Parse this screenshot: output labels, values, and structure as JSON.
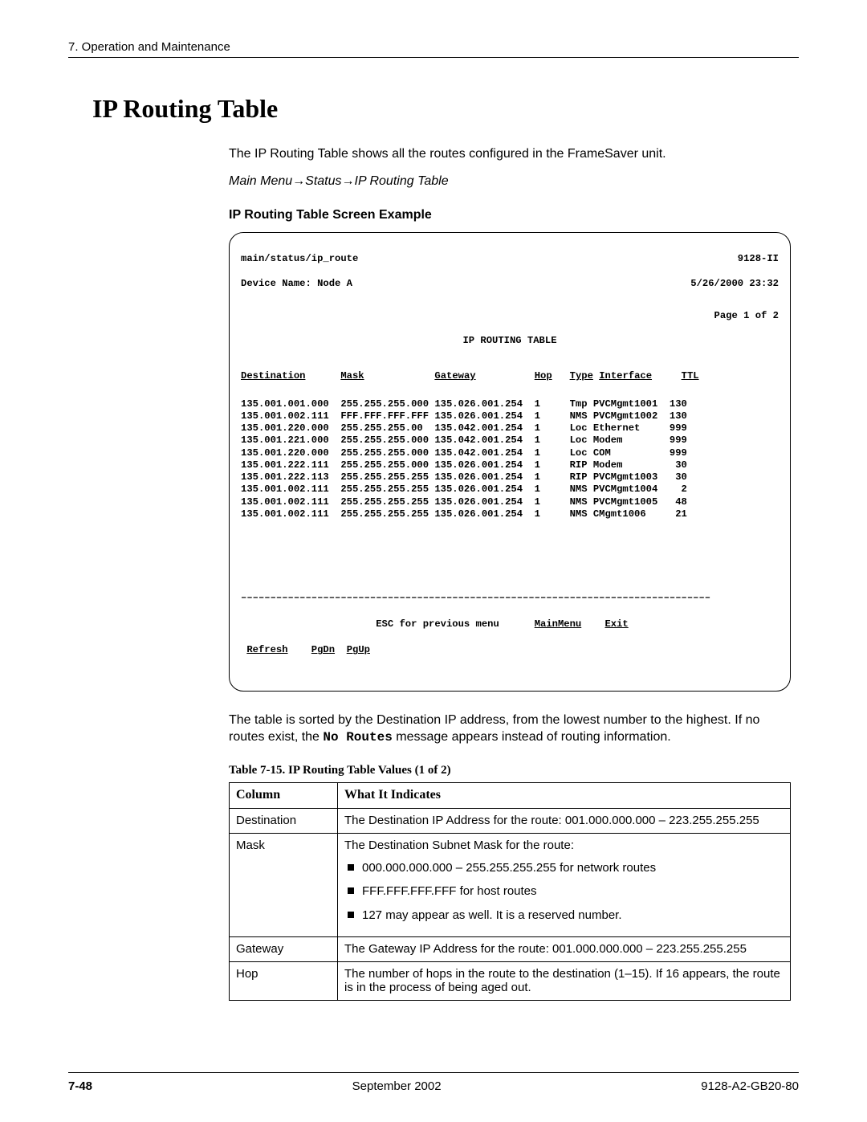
{
  "header": {
    "running": "7. Operation and Maintenance"
  },
  "section_title": "IP Routing Table",
  "intro": "The IP Routing Table shows all the routes configured in the FrameSaver unit.",
  "nav_path": "Main Menu→Status→IP Routing Table",
  "screen_example_label": "IP Routing Table Screen Example",
  "terminal": {
    "path": "main/status/ip_route",
    "model": "9128-II",
    "device_label": "Device Name: Node A",
    "timestamp": "5/26/2000 23:32",
    "page_indicator": "Page 1 of 2",
    "title": "IP ROUTING TABLE",
    "column_headers": {
      "dest": "Destination",
      "mask": "Mask",
      "gateway": "Gateway",
      "hop": "Hop",
      "type": "Type",
      "interface": "Interface",
      "ttl": "TTL"
    },
    "rows": [
      {
        "dest": "135.001.001.000",
        "mask": "255.255.255.000",
        "gateway": "135.026.001.254",
        "hop": "1",
        "type": "Tmp",
        "iface": "PVCMgmt1001",
        "ttl": "130"
      },
      {
        "dest": "135.001.002.111",
        "mask": "FFF.FFF.FFF.FFF",
        "gateway": "135.026.001.254",
        "hop": "1",
        "type": "NMS",
        "iface": "PVCMgmt1002",
        "ttl": "130"
      },
      {
        "dest": "135.001.220.000",
        "mask": "255.255.255.00",
        "gateway": "135.042.001.254",
        "hop": "1",
        "type": "Loc",
        "iface": "Ethernet",
        "ttl": "999"
      },
      {
        "dest": "135.001.221.000",
        "mask": "255.255.255.000",
        "gateway": "135.042.001.254",
        "hop": "1",
        "type": "Loc",
        "iface": "Modem",
        "ttl": "999"
      },
      {
        "dest": "135.001.220.000",
        "mask": "255.255.255.000",
        "gateway": "135.042.001.254",
        "hop": "1",
        "type": "Loc",
        "iface": "COM",
        "ttl": "999"
      },
      {
        "dest": "135.001.222.111",
        "mask": "255.255.255.000",
        "gateway": "135.026.001.254",
        "hop": "1",
        "type": "RIP",
        "iface": "Modem",
        "ttl": "30"
      },
      {
        "dest": "135.001.222.113",
        "mask": "255.255.255.255",
        "gateway": "135.026.001.254",
        "hop": "1",
        "type": "RIP",
        "iface": "PVCMgmt1003",
        "ttl": "30"
      },
      {
        "dest": "135.001.002.111",
        "mask": "255.255.255.255",
        "gateway": "135.026.001.254",
        "hop": "1",
        "type": "NMS",
        "iface": "PVCMgmt1004",
        "ttl": "2"
      },
      {
        "dest": "135.001.002.111",
        "mask": "255.255.255.255",
        "gateway": "135.026.001.254",
        "hop": "1",
        "type": "NMS",
        "iface": "PVCMgmt1005",
        "ttl": "48"
      },
      {
        "dest": "135.001.002.111",
        "mask": "255.255.255.255",
        "gateway": "135.026.001.254",
        "hop": "1",
        "type": "NMS",
        "iface": "CMgmt1006",
        "ttl": "21"
      }
    ],
    "separator": "––––––––––––––––––––––––––––––––––––––––––––––––––––––––––––––––––––––––––––––––",
    "footer_line1_prefix": "ESC for previous menu",
    "footer_line1_menu": "MainMenu",
    "footer_line1_exit": "Exit",
    "footer_line2_refresh": "Refresh",
    "footer_line2_pgdn": "PgDn",
    "footer_line2_pgup": "PgUp"
  },
  "after_para_pre": "The table is sorted by the Destination IP address, from the lowest number to the highest. If no routes exist, the ",
  "after_para_mono": "No Routes",
  "after_para_post": " message appears instead of routing information.",
  "table_caption": "Table 7-15.  IP Routing Table Values (1 of 2)",
  "values_table": {
    "head_col": "Column",
    "head_desc": "What It Indicates",
    "rows": [
      {
        "col": "Destination",
        "desc": "The Destination IP Address for the route: 001.000.000.000 – 223.255.255.255"
      },
      {
        "col": "Mask",
        "desc_intro": "The Destination Subnet Mask for the route:",
        "bullets": [
          "000.000.000.000 – 255.255.255.255 for network routes",
          "FFF.FFF.FFF.FFF for host routes",
          "127 may appear as well. It is a reserved number."
        ]
      },
      {
        "col": "Gateway",
        "desc": "The Gateway IP Address for the route: 001.000.000.000 – 223.255.255.255"
      },
      {
        "col": "Hop",
        "desc": "The number of hops in the route to the destination (1–15). If 16 appears, the route is in the process of being aged out."
      }
    ]
  },
  "footer": {
    "page": "7-48",
    "date": "September 2002",
    "docnum": "9128-A2-GB20-80"
  }
}
